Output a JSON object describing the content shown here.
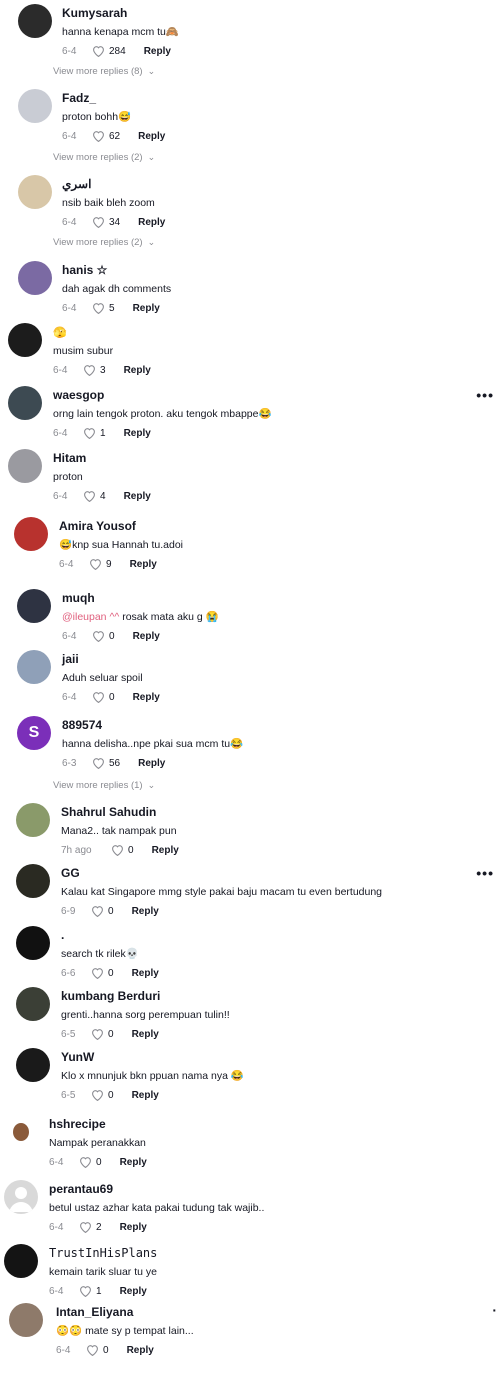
{
  "comments": [
    {
      "username": "Kumysarah",
      "text": "hanna kenapa mcm tu🙈",
      "date": "6-4",
      "likes": "284",
      "reply": "Reply",
      "avatar_color": "#2b2b2b"
    },
    {
      "username": "Fadz_",
      "text": "proton bohh😅",
      "date": "6-4",
      "likes": "62",
      "reply": "Reply",
      "avatar_color": "#c9ccd4"
    },
    {
      "username": "اسري",
      "text": "nsib baik bleh zoom",
      "date": "6-4",
      "likes": "34",
      "reply": "Reply",
      "avatar_color": "#d8c7a8"
    },
    {
      "username": "hanis ☆",
      "text": "dah agak dh comments",
      "date": "6-4",
      "likes": "5",
      "reply": "Reply",
      "avatar_color": "#7b6aa3"
    },
    {
      "username": "🫣",
      "text": "musim subur",
      "date": "6-4",
      "likes": "3",
      "reply": "Reply",
      "avatar_color": "#1c1c1c"
    },
    {
      "username": "waesgop",
      "text": "orng lain tengok proton. aku tengok mbappe😂",
      "date": "6-4",
      "likes": "1",
      "reply": "Reply",
      "avatar_color": "#3d4a52"
    },
    {
      "username": "Hitam",
      "text": "proton",
      "date": "6-4",
      "likes": "4",
      "reply": "Reply",
      "avatar_color": "#9a9aa0"
    },
    {
      "username": "Amira Yousof",
      "text": "😅knp sua Hannah tu.adoi",
      "date": "6-4",
      "likes": "9",
      "reply": "Reply",
      "avatar_color": "#b8322e"
    },
    {
      "username": "muqh",
      "mention": "@ileupan ^^",
      "text": " rosak mata aku g 😭",
      "date": "6-4",
      "likes": "0",
      "reply": "Reply",
      "avatar_color": "#2e3342"
    },
    {
      "username": "jaii",
      "text": "Aduh seluar spoil",
      "date": "6-4",
      "likes": "0",
      "reply": "Reply",
      "avatar_color": "#8fa0b8"
    },
    {
      "username": "889574",
      "text": "hanna delisha..npe pkai sua mcm tu😂",
      "date": "6-3",
      "likes": "56",
      "reply": "Reply",
      "avatar_color": "#7b2fb9",
      "avatar_letter": "S"
    },
    {
      "username": "Shahrul Sahudin",
      "text": "Mana2.. tak nampak pun",
      "date": "7h ago",
      "likes": "0",
      "reply": "Reply",
      "avatar_color": "#8a9a6a"
    },
    {
      "username": "GG",
      "text": "Kalau kat Singapore mmg style pakai baju macam tu even bertudung",
      "date": "6-9",
      "likes": "0",
      "reply": "Reply",
      "avatar_color": "#2a2a22"
    },
    {
      "username": ".",
      "text": "search tk rilek💀",
      "date": "6-6",
      "likes": "0",
      "reply": "Reply",
      "avatar_color": "#111111"
    },
    {
      "username": "kumbang Berduri",
      "text": "grenti..hanna sorg perempuan tulin!!",
      "date": "6-5",
      "likes": "0",
      "reply": "Reply",
      "avatar_color": "#3b3f36"
    },
    {
      "username": "YunW",
      "text": "Klo x mnunjuk bkn ppuan nama nya 😂",
      "date": "6-5",
      "likes": "0",
      "reply": "Reply",
      "avatar_color": "#1a1a1a"
    },
    {
      "username": "hshrecipe",
      "text": "Nampak peranakkan",
      "date": "6-4",
      "likes": "0",
      "reply": "Reply",
      "avatar_color": "#ffffff"
    },
    {
      "username": "perantau69",
      "text": "betul ustaz azhar kata pakai tudung tak wajib..",
      "date": "6-4",
      "likes": "2",
      "reply": "Reply",
      "avatar_color": "#d9d9d9"
    },
    {
      "username": "TrustInHisPlans",
      "text": "kemain tarik sluar tu ye",
      "date": "6-4",
      "likes": "1",
      "reply": "Reply",
      "avatar_color": "#141414"
    },
    {
      "username": "Intan_Eliyana",
      "text": "😳😳 mate sy p tempat lain...",
      "date": "6-4",
      "likes": "0",
      "reply": "Reply",
      "avatar_color": "#8e7a6a"
    }
  ],
  "view_more": [
    "View more replies (8)",
    "View more replies (2)",
    "View more replies (2)",
    "View more replies (1)"
  ],
  "more_options_label": "•••"
}
